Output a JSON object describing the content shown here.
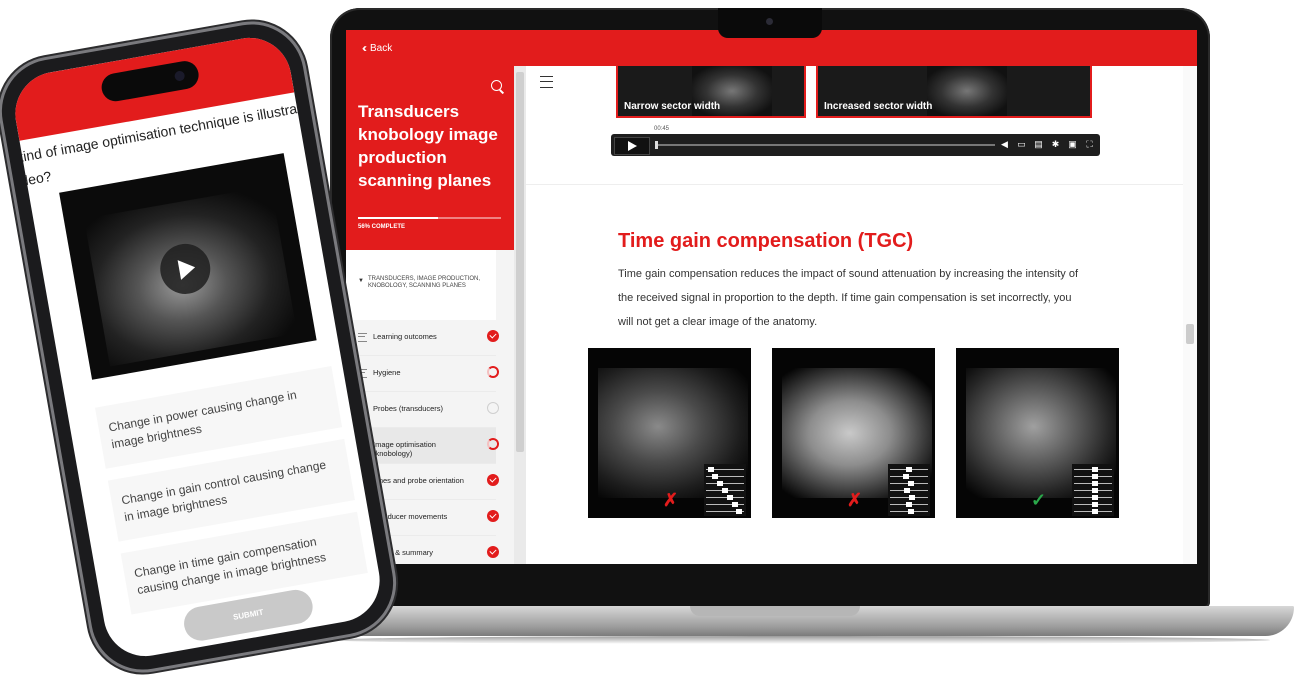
{
  "laptop": {
    "topbar": {
      "back_label": "Back"
    },
    "sidebar": {
      "course_title": "Transducers knobology image production scanning planes",
      "progress_label": "56% COMPLETE",
      "progress_fraction": 0.56,
      "section_header": "Transducers, image production, knobology, scanning planes",
      "items": [
        {
          "label": "Learning outcomes",
          "status": "done"
        },
        {
          "label": "Hygiene",
          "status": "partial"
        },
        {
          "label": "Probes (transducers)",
          "status": "empty"
        },
        {
          "label": "Image optimisation (knobology)",
          "status": "partial"
        },
        {
          "label": "lanes and probe orientation",
          "status": "done"
        },
        {
          "label": "ransducer movements",
          "status": "done"
        },
        {
          "label": "points & summary",
          "status": "done"
        }
      ]
    },
    "main": {
      "thumbs": [
        {
          "caption": "Narrow sector width"
        },
        {
          "caption": "Increased sector width"
        }
      ],
      "video": {
        "time": "00:45",
        "progress": 0.0
      },
      "heading": "Time gain compensation (TGC)",
      "body": "Time gain compensation reduces the impact of sound attenuation by increasing the intensity of the received signal in proportion to the depth. If time gain compensation is set incorrectly, you will not get a clear image of the anatomy.",
      "panels": [
        {
          "mark": "✗",
          "correct": false
        },
        {
          "mark": "✗",
          "correct": false
        },
        {
          "mark": "✓",
          "correct": true
        }
      ]
    }
  },
  "phone": {
    "question": "kind of image optimisation technique is illustra deo?",
    "answers": [
      "Change in power causing change in image brightness",
      "Change in gain control causing change in image brightness",
      "Change in time gain compensation causing change in image brightness"
    ],
    "submit_label": "SUBMIT"
  },
  "colors": {
    "accent": "#e21c1c",
    "success": "#2aa84a"
  }
}
